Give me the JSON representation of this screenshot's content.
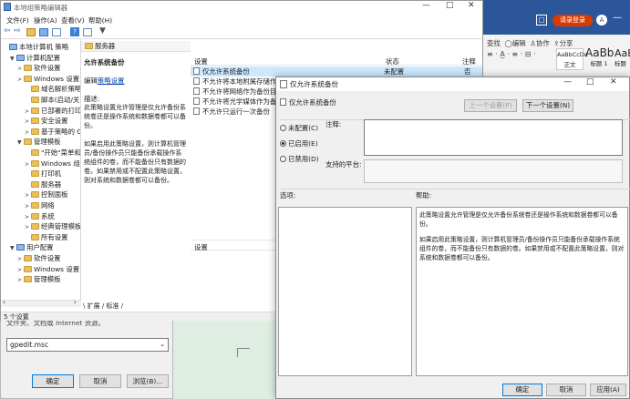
{
  "word": {
    "login_btn": "请录登录",
    "avatar_letter": "A",
    "ribbon": {
      "r1": [
        "查找",
        "编辑",
        "协作",
        "分享"
      ],
      "styles": [
        "AaBbCcDd",
        "AaBb",
        "AaB"
      ],
      "style_names": [
        "正文",
        "标题 1",
        "标题"
      ]
    }
  },
  "gp": {
    "title": "本地组策略编辑器",
    "menu": [
      "文件(F)",
      "操作(A)",
      "查看(V)",
      "帮助(H)"
    ],
    "tree": [
      {
        "label": "本地计算机 策略",
        "level": 0,
        "exp": ""
      },
      {
        "label": "计算机配置",
        "level": 1,
        "exp": "▼"
      },
      {
        "label": "软件设置",
        "level": 2,
        "exp": ">"
      },
      {
        "label": "Windows 设置",
        "level": 2,
        "exp": ">"
      },
      {
        "label": "域名解析策略",
        "level": 3,
        "exp": ""
      },
      {
        "label": "脚本(启动/关",
        "level": 3,
        "exp": ""
      },
      {
        "label": "已部署的打印",
        "level": 3,
        "exp": ">"
      },
      {
        "label": "安全设置",
        "level": 3,
        "exp": ">"
      },
      {
        "label": "基于策略的 C",
        "level": 3,
        "exp": ">"
      },
      {
        "label": "管理模板",
        "level": 2,
        "exp": "▼"
      },
      {
        "label": "\"开始\"菜单和",
        "level": 3,
        "exp": ""
      },
      {
        "label": "Windows 组",
        "level": 3,
        "exp": ">"
      },
      {
        "label": "打印机",
        "level": 3,
        "exp": ""
      },
      {
        "label": "服务器",
        "level": 3,
        "exp": ""
      },
      {
        "label": "控制面板",
        "level": 3,
        "exp": ">"
      },
      {
        "label": "网络",
        "level": 3,
        "exp": ">"
      },
      {
        "label": "系统",
        "level": 3,
        "exp": ">"
      },
      {
        "label": "经典管理模板",
        "level": 3,
        "exp": ">"
      },
      {
        "label": "所有设置",
        "level": 3,
        "exp": ""
      },
      {
        "label": "用户配置",
        "level": 1,
        "exp": "▼"
      },
      {
        "label": "软件设置",
        "level": 2,
        "exp": ">"
      },
      {
        "label": "Windows 设置",
        "level": 2,
        "exp": ">"
      },
      {
        "label": "管理模板",
        "level": 2,
        "exp": ">"
      }
    ],
    "folder_header": "服务器",
    "desc_title": "允许系统备份",
    "desc_edit_prefix": "编辑",
    "desc_edit_link": "策略设置",
    "desc_label": "描述:",
    "desc_p1": "此策略设置允许管理是仅允许备份系统卷还是操作系统和数据卷都可以备份。",
    "desc_p2": "如果启用此策略设置，则计算机管理员/备份操作员只能备份承载操作系统组件的卷，而不能备份只有数据的卷。如果禁用或不配置此策略设置，则对系统和数据卷都可以备份。",
    "list_header": {
      "setting": "设置",
      "state": "状态",
      "note": "注释"
    },
    "list_header_rest": "",
    "policies": [
      {
        "name": "仅允许系统备份",
        "state": "未配置",
        "note": "否"
      },
      {
        "name": "不允许将本地附属存储作为",
        "state": "",
        "note": ""
      },
      {
        "name": "不允许将网络作为备份目标",
        "state": "",
        "note": ""
      },
      {
        "name": "不允许将光学媒体作为备份",
        "state": "",
        "note": ""
      },
      {
        "name": "不允许只运行一次备份",
        "state": "",
        "note": ""
      }
    ],
    "tabs": [
      "扩展",
      "标准"
    ],
    "status_text": "5 个设置"
  },
  "run": {
    "hint": "文件夹、文档或 Internet 资源。",
    "input_value": "gpedit.msc",
    "buttons": [
      "确定",
      "取消",
      "浏览(B)..."
    ]
  },
  "dialog": {
    "title": "仅允许系统备份",
    "subtitle": "仅允许系统备份",
    "prev_btn": "上一个设置(P)",
    "next_btn": "下一个设置(N)",
    "options": [
      "未配置(C)",
      "已启用(E)",
      "已禁用(D)"
    ],
    "selected_index": 1,
    "comment_label": "注释:",
    "supported_label": "支持的平台:",
    "options_label": "选项:",
    "help_label": "帮助:",
    "help_p1": "此策略设置允许管理是仅允许备份系统卷还是操作系统和数据卷都可以备份。",
    "help_p2": "如果启用此策略设置，则计算机管理员/备份操作员只能备份承载操作系统组件的卷，而不能备份只有数据的卷。如果禁用或不配置此策略设置，则对系统和数据卷都可以备份。",
    "ok": "确定",
    "cancel": "取消",
    "apply": "应用(A)"
  }
}
